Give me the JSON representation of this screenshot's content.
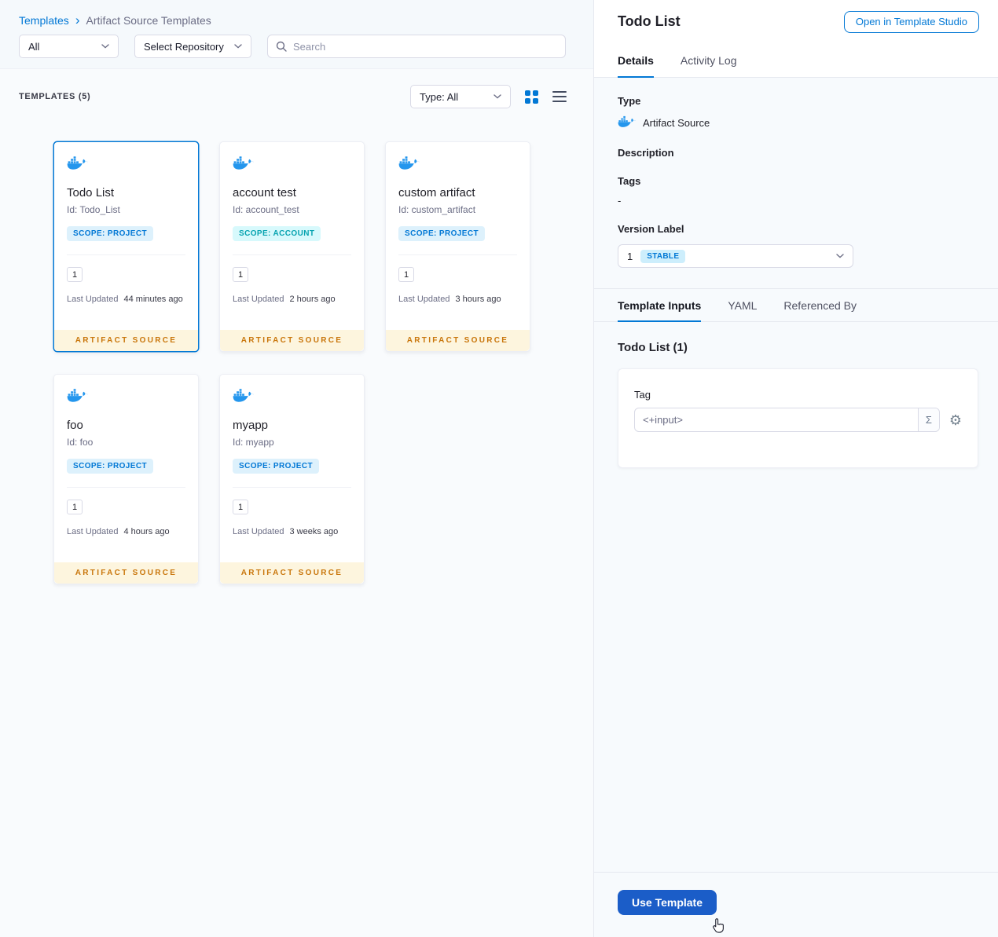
{
  "colors": {
    "primary_blue": "#0278d5",
    "docker_blue": "#2496ed",
    "artifact_badge_text": "#c9760b",
    "artifact_badge_bg": "#fdf5de",
    "use_template_button_bg": "#1b5dc8",
    "scope_project_text": "#0278d5",
    "scope_account_text": "#07a3b0",
    "stable_badge_bg": "#cdeefc"
  },
  "breadcrumb": {
    "root": "Templates",
    "separator": "›",
    "current": "Artifact Source Templates"
  },
  "filters": {
    "scope": "All",
    "repository": "Select Repository",
    "search_placeholder": "Search"
  },
  "templates_header": {
    "count": "TEMPLATES (5)",
    "type_filter": "Type: All"
  },
  "cards": [
    {
      "title": "Todo List",
      "id": "Id: Todo_List",
      "scope_label": "SCOPE: PROJECT",
      "scope_type": "project",
      "version": "1",
      "updated_label": "Last Updated",
      "updated_value": "44 minutes ago",
      "type_badge": "ARTIFACT SOURCE",
      "selected": true
    },
    {
      "title": "account test",
      "id": "Id: account_test",
      "scope_label": "SCOPE: ACCOUNT",
      "scope_type": "account",
      "version": "1",
      "updated_label": "Last Updated",
      "updated_value": "2 hours ago",
      "type_badge": "ARTIFACT SOURCE",
      "selected": false
    },
    {
      "title": "custom artifact",
      "id": "Id: custom_artifact",
      "scope_label": "SCOPE: PROJECT",
      "scope_type": "project",
      "version": "1",
      "updated_label": "Last Updated",
      "updated_value": "3 hours ago",
      "type_badge": "ARTIFACT SOURCE",
      "selected": false
    },
    {
      "title": "foo",
      "id": "Id: foo",
      "scope_label": "SCOPE: PROJECT",
      "scope_type": "project",
      "version": "1",
      "updated_label": "Last Updated",
      "updated_value": "4 hours ago",
      "type_badge": "ARTIFACT SOURCE",
      "selected": false
    },
    {
      "title": "myapp",
      "id": "Id: myapp",
      "scope_label": "SCOPE: PROJECT",
      "scope_type": "project",
      "version": "1",
      "updated_label": "Last Updated",
      "updated_value": "3 weeks ago",
      "type_badge": "ARTIFACT SOURCE",
      "selected": false
    }
  ],
  "panel": {
    "title": "Todo List",
    "open_in_studio": "Open in Template Studio",
    "tabs": [
      "Details",
      "Activity Log"
    ],
    "details": {
      "type_label": "Type",
      "type_value": "Artifact Source",
      "description_label": "Description",
      "tags_label": "Tags",
      "tags_value": "-",
      "version_label": "Version Label",
      "version_value": "1",
      "version_badge": "STABLE"
    },
    "inputs_tabs": [
      "Template Inputs",
      "YAML",
      "Referenced By"
    ],
    "inputs": {
      "title": "Todo List (1)",
      "tag_label": "Tag",
      "tag_value": "<+input>",
      "expression_symbol": "Σ",
      "gear_symbol": "⚙"
    },
    "use_template": "Use Template"
  }
}
